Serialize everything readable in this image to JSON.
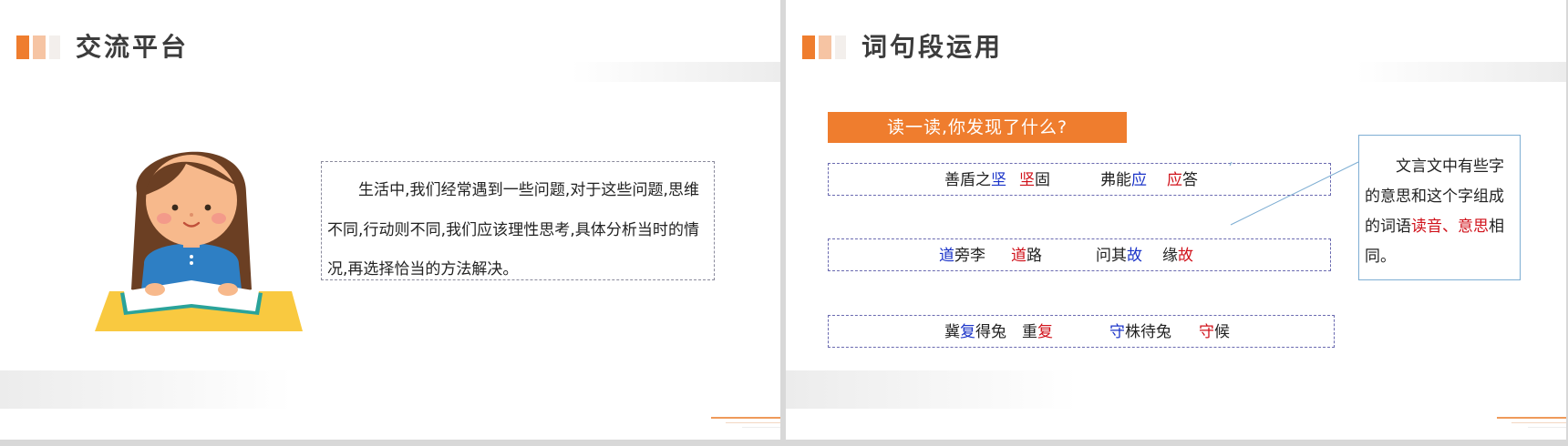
{
  "left_slide": {
    "title": "交流平台",
    "paragraph": "生活中,我们经常遇到一些问题,对于这些问题,思维不同,行动则不同,我们应该理性思考,具体分析当时的情况,再选择恰当的方法解决。"
  },
  "right_slide": {
    "title": "词句段运用",
    "banner": "读一读,你发现了什么?",
    "rows": [
      {
        "w1": {
          "a": "善盾之",
          "b": "坚",
          "c": ""
        },
        "w2": {
          "a": "",
          "b": "坚",
          "c": "固"
        },
        "w3": {
          "a": "弗能",
          "b": "应",
          "c": ""
        },
        "w4": {
          "a": "",
          "b": "应",
          "c": "答"
        }
      },
      {
        "w1": {
          "a": "",
          "b": "道",
          "c": "旁李"
        },
        "w2": {
          "a": "",
          "b": "道",
          "c": "路"
        },
        "w3": {
          "a": "问其",
          "b": "故",
          "c": ""
        },
        "w4": {
          "a": "缘",
          "b": "故",
          "c": ""
        }
      },
      {
        "w1": {
          "a": "冀",
          "b": "复",
          "c": "得兔"
        },
        "w2": {
          "a": "重",
          "b": "复",
          "c": ""
        },
        "w3": {
          "a": "",
          "b": "守",
          "c": "株待兔"
        },
        "w4": {
          "a": "",
          "b": "守",
          "c": "候"
        }
      }
    ],
    "note": {
      "part1": "文言文中有些字的意思和这个字组成的词语",
      "highlight": "读音、意思",
      "part2": "相同。"
    }
  },
  "colors": {
    "accent_orange": "#ef7d2e",
    "classical_word": "#1a33c8",
    "modern_word": "#d0111a",
    "note_border": "#7eaed3"
  },
  "icons": [
    "girl-reading-illustration",
    "title-squares-icon"
  ]
}
